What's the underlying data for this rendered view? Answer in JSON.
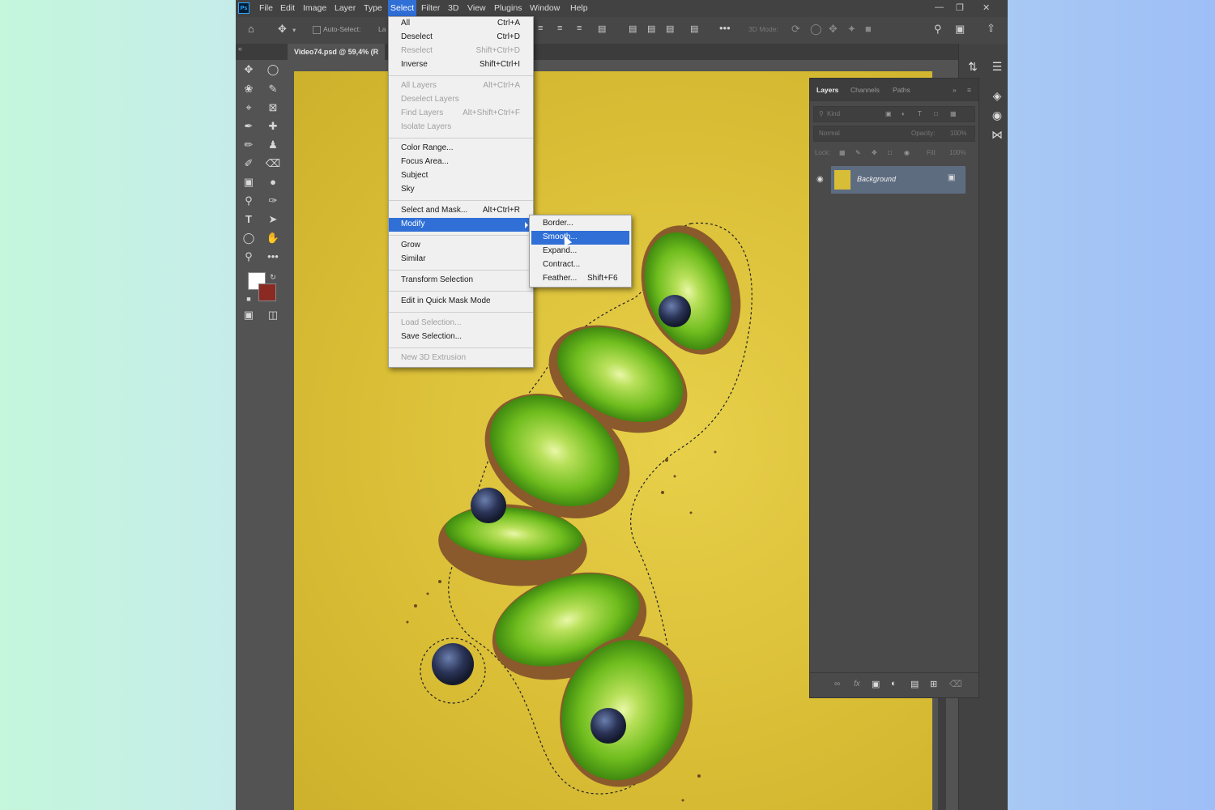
{
  "menubar": {
    "items": [
      "File",
      "Edit",
      "Image",
      "Layer",
      "Type",
      "Select",
      "Filter",
      "3D",
      "View",
      "Plugins",
      "Window",
      "Help"
    ],
    "active": "Select",
    "logo": "Ps"
  },
  "options": {
    "auto_select": "Auto-Select:",
    "layer_trunc": "La",
    "mode_3d": "3D Mode:"
  },
  "document": {
    "tab_title": "Video74.psd @ 59,4% (R"
  },
  "select_menu": {
    "items": [
      {
        "label": "All",
        "shortcut": "Ctrl+A",
        "disabled": false
      },
      {
        "label": "Deselect",
        "shortcut": "Ctrl+D",
        "disabled": false
      },
      {
        "label": "Reselect",
        "shortcut": "Shift+Ctrl+D",
        "disabled": true
      },
      {
        "label": "Inverse",
        "shortcut": "Shift+Ctrl+I",
        "disabled": false
      },
      {
        "label": "All Layers",
        "shortcut": "Alt+Ctrl+A",
        "disabled": true
      },
      {
        "label": "Deselect Layers",
        "shortcut": "",
        "disabled": true
      },
      {
        "label": "Find Layers",
        "shortcut": "Alt+Shift+Ctrl+F",
        "disabled": true
      },
      {
        "label": "Isolate Layers",
        "shortcut": "",
        "disabled": true
      },
      {
        "label": "Color Range...",
        "shortcut": "",
        "disabled": false
      },
      {
        "label": "Focus Area...",
        "shortcut": "",
        "disabled": false
      },
      {
        "label": "Subject",
        "shortcut": "",
        "disabled": false
      },
      {
        "label": "Sky",
        "shortcut": "",
        "disabled": false
      },
      {
        "label": "Select and Mask...",
        "shortcut": "Alt+Ctrl+R",
        "disabled": false
      },
      {
        "label": "Modify",
        "shortcut": "",
        "disabled": false
      },
      {
        "label": "Grow",
        "shortcut": "",
        "disabled": false
      },
      {
        "label": "Similar",
        "shortcut": "",
        "disabled": false
      },
      {
        "label": "Transform Selection",
        "shortcut": "",
        "disabled": false
      },
      {
        "label": "Edit in Quick Mask Mode",
        "shortcut": "",
        "disabled": false
      },
      {
        "label": "Load Selection...",
        "shortcut": "",
        "disabled": true
      },
      {
        "label": "Save Selection...",
        "shortcut": "",
        "disabled": false
      },
      {
        "label": "New 3D Extrusion",
        "shortcut": "",
        "disabled": true
      }
    ]
  },
  "modify_submenu": {
    "items": [
      {
        "label": "Border...",
        "shortcut": ""
      },
      {
        "label": "Smooth...",
        "shortcut": ""
      },
      {
        "label": "Expand...",
        "shortcut": ""
      },
      {
        "label": "Contract...",
        "shortcut": ""
      },
      {
        "label": "Feather...",
        "shortcut": "Shift+F6"
      }
    ],
    "highlighted": "Smooth..."
  },
  "layers_panel": {
    "tabs": [
      "Layers",
      "Channels",
      "Paths"
    ],
    "active_tab": "Layers",
    "kind_placeholder": "Kind",
    "blend_mode": "Normal",
    "opacity_label": "Opacity:",
    "opacity_value": "100%",
    "lock_label": "Lock:",
    "fill_label": "Fill:",
    "fill_value": "100%",
    "layer_name": "Background"
  },
  "colors": {
    "foreground": "#ffffff",
    "background": "#8b2a22",
    "canvas_yellow": "#dcc038",
    "highlight": "#2f6fd6"
  }
}
